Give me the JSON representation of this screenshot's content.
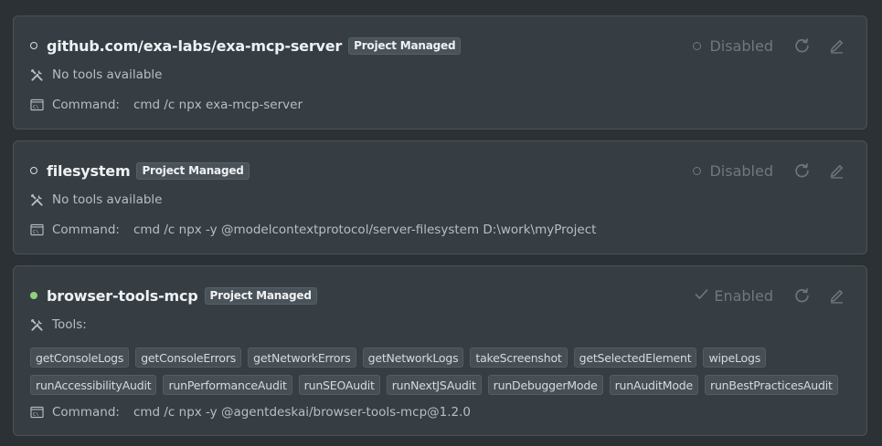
{
  "servers": [
    {
      "name": "github.com/exa-labs/exa-mcp-server",
      "badge": "Project Managed",
      "status": "Disabled",
      "active": false,
      "tools_text": "No tools available",
      "command_label": "Command:",
      "command": "cmd /c npx exa-mcp-server"
    },
    {
      "name": "filesystem",
      "badge": "Project Managed",
      "status": "Disabled",
      "active": false,
      "tools_text": "No tools available",
      "command_label": "Command:",
      "command": "cmd /c npx -y @modelcontextprotocol/server-filesystem D:\\work\\myProject"
    },
    {
      "name": "browser-tools-mcp",
      "badge": "Project Managed",
      "status": "Enabled",
      "active": true,
      "tools_text": "Tools:",
      "tools_row1": [
        "getConsoleLogs",
        "getConsoleErrors",
        "getNetworkErrors",
        "getNetworkLogs",
        "takeScreenshot",
        "getSelectedElement",
        "wipeLogs"
      ],
      "tools_row2": [
        "runAccessibilityAudit",
        "runPerformanceAudit",
        "runSEOAudit",
        "runNextJSAudit",
        "runDebuggerMode",
        "runAuditMode",
        "runBestPracticesAudit"
      ],
      "command_label": "Command:",
      "command": "cmd /c npx -y @agentdeskai/browser-tools-mcp@1.2.0"
    }
  ],
  "icons": {
    "status_dot": "circle-icon",
    "tools": "tools-icon",
    "command": "terminal-icon",
    "refresh": "refresh-icon",
    "edit": "pencil-icon",
    "enabled": "check-icon"
  },
  "colors": {
    "background": "#2b3135",
    "card": "#363e44",
    "active_dot": "#8fd17d",
    "muted": "#6e787f"
  }
}
